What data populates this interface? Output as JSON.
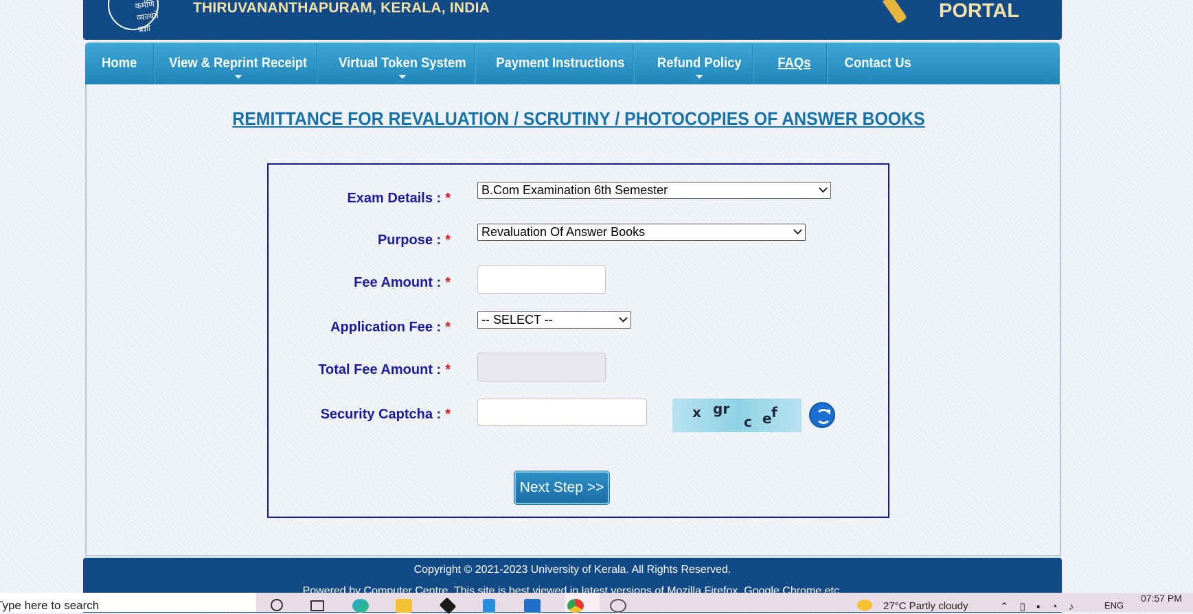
{
  "header": {
    "logo_text": "कर्मणि व्यज्यते प्रज्ञा",
    "location": "THIRUVANANTHAPURAM, KERALA, INDIA",
    "portal_label": "PORTAL"
  },
  "nav": {
    "items": [
      {
        "label": "Home",
        "has_dropdown": false
      },
      {
        "label": "View & Reprint Receipt",
        "has_dropdown": true
      },
      {
        "label": "Virtual Token System",
        "has_dropdown": true
      },
      {
        "label": "Payment Instructions",
        "has_dropdown": false
      },
      {
        "label": "Refund Policy",
        "has_dropdown": true
      },
      {
        "label": "FAQs",
        "has_dropdown": false
      },
      {
        "label": "Contact Us",
        "has_dropdown": false
      }
    ]
  },
  "page_title": "REMITTANCE FOR REVALUATION / SCRUTINY / PHOTOCOPIES OF ANSWER BOOKS",
  "form": {
    "exam_details": {
      "label": "Exam Details :",
      "value": "B.Com Examination 6th Semester"
    },
    "purpose": {
      "label": "Purpose :",
      "value": "Revaluation Of Answer Books"
    },
    "fee_amount": {
      "label": "Fee Amount :",
      "value": ""
    },
    "application_fee": {
      "label": "Application Fee :",
      "value": "-- SELECT --"
    },
    "total_fee_amount": {
      "label": "Total Fee Amount :",
      "value": ""
    },
    "security_captcha": {
      "label": "Security Captcha :",
      "value": ""
    },
    "required_mark": "*",
    "captcha_chars": [
      "x",
      "gr",
      "c",
      "e",
      "f"
    ],
    "next_button": "Next Step >>"
  },
  "footer": {
    "copyright": "Copyright © 2021-2023 University of Kerala. All Rights Reserved.",
    "powered": "Powered by Computer Centre. This site is best viewed in latest versions of Mozilla Firefox, Google Chrome etc."
  },
  "taskbar": {
    "search_placeholder": "Type here to search",
    "weather": "27°C  Partly cloudy",
    "language": "ENG",
    "time": "07:57 PM"
  },
  "colors": {
    "header_blue": "#114a86",
    "nav_blue": "#2b95c8",
    "label_navy": "#1a1a9a",
    "required_red": "#e01919",
    "title_blue": "#1573a8"
  }
}
